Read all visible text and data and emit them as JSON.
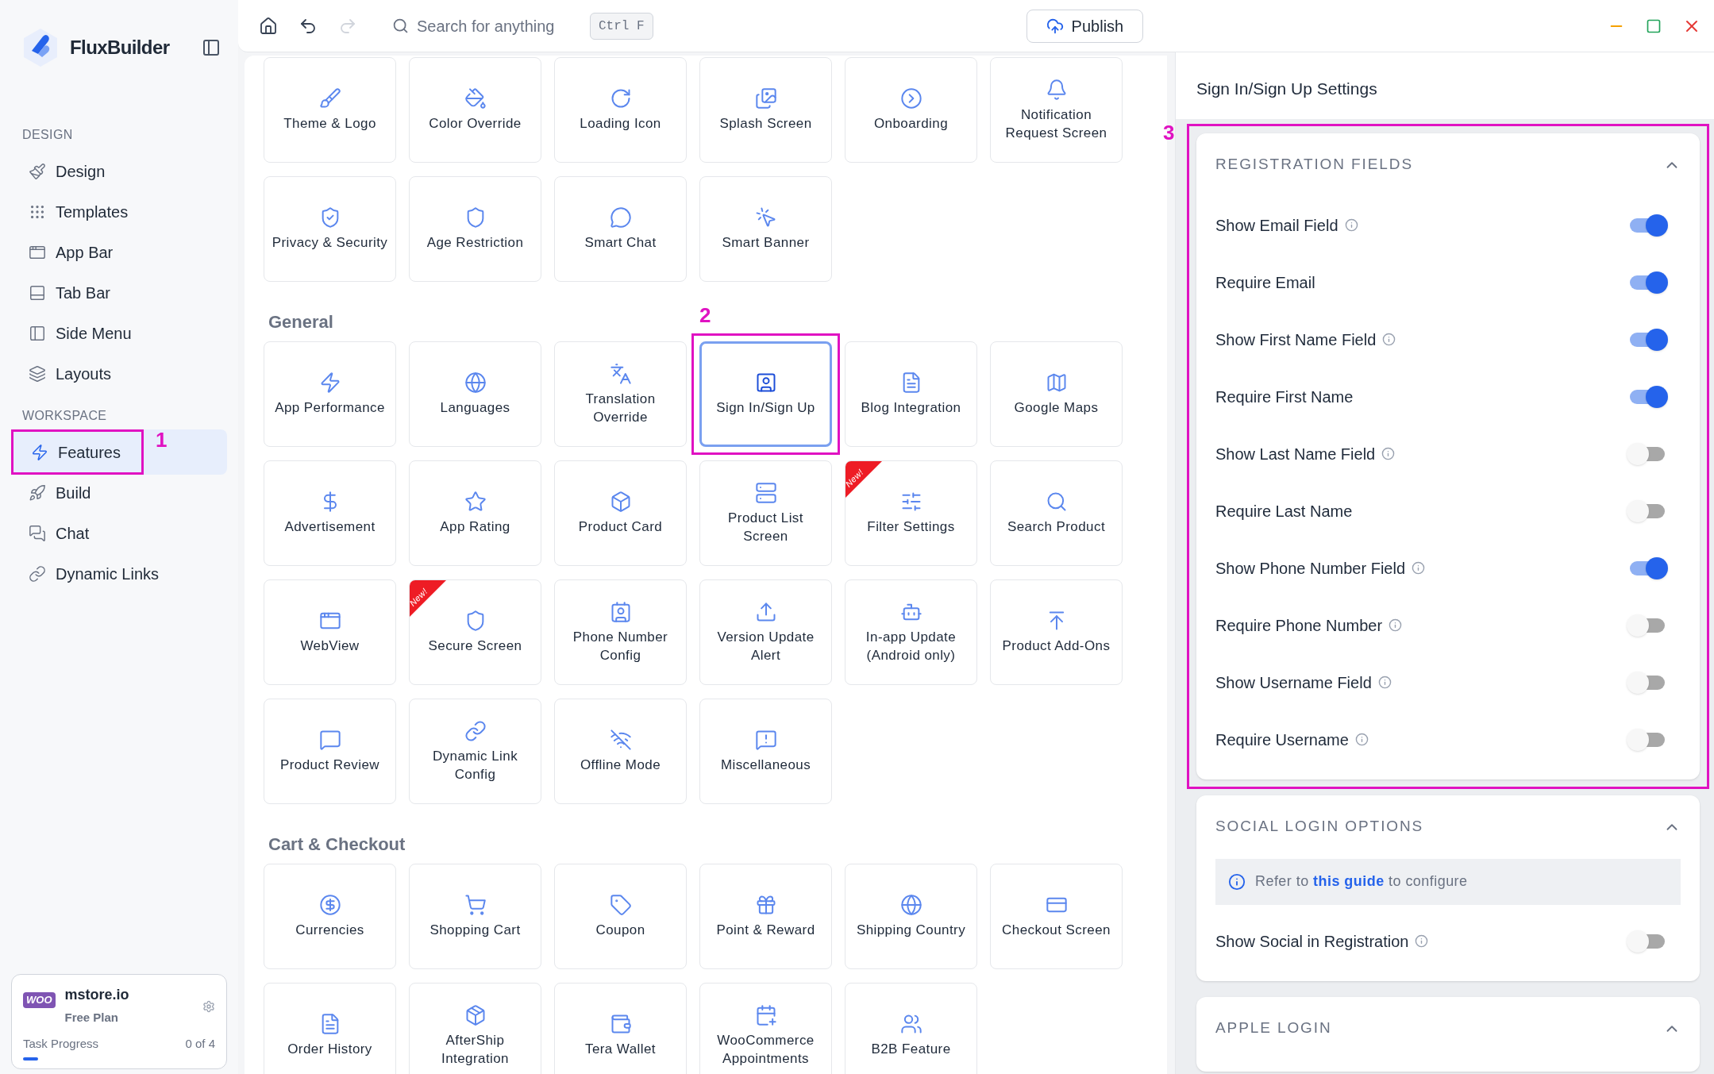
{
  "sidebar": {
    "brand": "FluxBuilder",
    "groups": [
      {
        "title": "DESIGN",
        "items": [
          {
            "label": "Design",
            "selected": false
          },
          {
            "label": "Templates",
            "selected": false
          },
          {
            "label": "App Bar",
            "selected": false
          },
          {
            "label": "Tab Bar",
            "selected": false
          },
          {
            "label": "Side Menu",
            "selected": false
          },
          {
            "label": "Layouts",
            "selected": false
          }
        ]
      },
      {
        "title": "WORKSPACE",
        "items": [
          {
            "label": "Features",
            "selected": true,
            "callout": "1"
          },
          {
            "label": "Build",
            "selected": false
          },
          {
            "label": "Chat",
            "selected": false
          },
          {
            "label": "Dynamic Links",
            "selected": false
          }
        ]
      }
    ],
    "workspace_card": {
      "logo_text": "WOO",
      "name": "mstore.io",
      "plan": "Free Plan",
      "progress_label": "Task Progress",
      "progress_count": "0 of 4",
      "level": 0.08
    }
  },
  "toolbar": {
    "redo_disabled": true,
    "search": {
      "placeholder": "Search for anything"
    },
    "shortcut": "Ctrl F",
    "publish": "Publish"
  },
  "feature_sections": [
    {
      "tiles": [
        {
          "label": "Theme & Logo",
          "selected": false
        },
        {
          "label": "Color Override",
          "selected": false
        },
        {
          "label": "Loading Icon",
          "selected": false
        },
        {
          "label": "Splash Screen",
          "selected": false
        },
        {
          "label": "Onboarding",
          "selected": false
        },
        {
          "label": "Notification Request Screen",
          "selected": false
        },
        {
          "label": "Privacy & Security",
          "selected": false
        },
        {
          "label": "Age Restriction",
          "selected": false
        },
        {
          "label": "Smart Chat",
          "selected": false
        },
        {
          "label": "Smart Banner",
          "selected": false
        }
      ]
    },
    {
      "title": "General",
      "tiles": [
        {
          "label": "App Performance",
          "selected": false
        },
        {
          "label": "Languages",
          "selected": false
        },
        {
          "label": "Translation Override",
          "selected": false
        },
        {
          "label": "Sign In/Sign Up",
          "selected": true,
          "callout": "2"
        },
        {
          "label": "Blog Integration",
          "selected": false
        },
        {
          "label": "Google Maps",
          "selected": false
        },
        {
          "label": "Advertisement",
          "selected": false
        },
        {
          "label": "App Rating",
          "selected": false
        },
        {
          "label": "Product Card",
          "selected": false
        },
        {
          "label": "Product List Screen",
          "selected": false
        },
        {
          "label": "Filter Settings",
          "selected": false,
          "badge": "New!"
        },
        {
          "label": "Search Product",
          "selected": false
        },
        {
          "label": "WebView",
          "selected": false
        },
        {
          "label": "Secure Screen",
          "selected": false,
          "badge": "New!"
        },
        {
          "label": "Phone Number Config",
          "selected": false
        },
        {
          "label": "Version Update Alert",
          "selected": false
        },
        {
          "label": "In-app Update (Android only)",
          "selected": false
        },
        {
          "label": "Product Add-Ons",
          "selected": false
        },
        {
          "label": "Product Review",
          "selected": false
        },
        {
          "label": "Dynamic Link Config",
          "selected": false
        },
        {
          "label": "Offline Mode",
          "selected": false
        },
        {
          "label": "Miscellaneous",
          "selected": false
        }
      ]
    },
    {
      "title": "Cart & Checkout",
      "tiles": [
        {
          "label": "Currencies",
          "selected": false
        },
        {
          "label": "Shopping Cart",
          "selected": false
        },
        {
          "label": "Coupon",
          "selected": false
        },
        {
          "label": "Point & Reward",
          "selected": false
        },
        {
          "label": "Shipping Country",
          "selected": false
        },
        {
          "label": "Checkout Screen",
          "selected": false
        },
        {
          "label": "Order History",
          "selected": false
        },
        {
          "label": "AfterShip Integration",
          "selected": false
        },
        {
          "label": "Tera Wallet",
          "selected": false
        },
        {
          "label": "WooCommerce Appointments",
          "selected": false
        },
        {
          "label": "B2B Feature",
          "selected": false
        }
      ]
    }
  ],
  "settings": {
    "title": "Sign In/Sign Up Settings",
    "sections": [
      {
        "title": "REGISTRATION FIELDS",
        "expanded": true,
        "callout": "3",
        "rows": [
          {
            "label": "Show Email Field",
            "info": true,
            "on": true
          },
          {
            "label": "Require Email",
            "info": false,
            "on": true
          },
          {
            "label": "Show First Name Field",
            "info": true,
            "on": true
          },
          {
            "label": "Require First Name",
            "info": false,
            "on": true
          },
          {
            "label": "Show Last Name Field",
            "info": true,
            "on": false
          },
          {
            "label": "Require Last Name",
            "info": false,
            "on": false
          },
          {
            "label": "Show Phone Number Field",
            "info": true,
            "on": true
          },
          {
            "label": "Require Phone Number",
            "info": true,
            "on": false
          },
          {
            "label": "Show Username Field",
            "info": true,
            "on": false
          },
          {
            "label": "Require Username",
            "info": true,
            "on": false
          }
        ]
      },
      {
        "title": "SOCIAL LOGIN OPTIONS",
        "expanded": true,
        "notice": {
          "prefix": "Refer to",
          "link": "this guide",
          "suffix": "to configure"
        },
        "rows": [
          {
            "label": "Show Social in Registration",
            "info": true,
            "on": false
          }
        ]
      },
      {
        "title": "APPLE LOGIN",
        "expanded": true
      }
    ]
  }
}
